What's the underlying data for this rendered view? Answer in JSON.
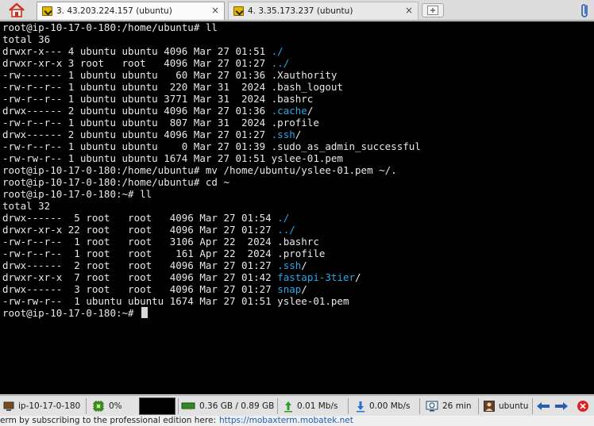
{
  "tabs": [
    {
      "label": "3. 43.203.224.157 (ubuntu)",
      "active": true
    },
    {
      "label": "4. 3.35.173.237 (ubuntu)",
      "active": false
    }
  ],
  "tab_close_glyph": "×",
  "terminal": {
    "colors": {
      "background": "#000000",
      "text": "#e8e8e8",
      "directory": "#2aa7e6"
    },
    "lines": [
      [
        {
          "t": "root@ip-10-17-0-180:/home/ubuntu# ll"
        }
      ],
      [
        {
          "t": "total 36"
        }
      ],
      [
        {
          "t": "drwxr-x--- 4 ubuntu ubuntu 4096 Mar 27 01:51 "
        },
        {
          "t": "./",
          "dir": true
        }
      ],
      [
        {
          "t": "drwxr-xr-x 3 root   root   4096 Mar 27 01:27 "
        },
        {
          "t": "../",
          "dir": true
        }
      ],
      [
        {
          "t": "-rw------- 1 ubuntu ubuntu   60 Mar 27 01:36 .Xauthority"
        }
      ],
      [
        {
          "t": "-rw-r--r-- 1 ubuntu ubuntu  220 Mar 31  2024 .bash_logout"
        }
      ],
      [
        {
          "t": "-rw-r--r-- 1 ubuntu ubuntu 3771 Mar 31  2024 .bashrc"
        }
      ],
      [
        {
          "t": "drwx------ 2 ubuntu ubuntu 4096 Mar 27 01:36 "
        },
        {
          "t": ".cache",
          "dir": true
        },
        {
          "t": "/"
        }
      ],
      [
        {
          "t": "-rw-r--r-- 1 ubuntu ubuntu  807 Mar 31  2024 .profile"
        }
      ],
      [
        {
          "t": "drwx------ 2 ubuntu ubuntu 4096 Mar 27 01:27 "
        },
        {
          "t": ".ssh",
          "dir": true
        },
        {
          "t": "/"
        }
      ],
      [
        {
          "t": "-rw-r--r-- 1 ubuntu ubuntu    0 Mar 27 01:39 .sudo_as_admin_successful"
        }
      ],
      [
        {
          "t": "-rw-rw-r-- 1 ubuntu ubuntu 1674 Mar 27 01:51 yslee-01.pem"
        }
      ],
      [
        {
          "t": "root@ip-10-17-0-180:/home/ubuntu# mv /home/ubuntu/yslee-01.pem ~/."
        }
      ],
      [
        {
          "t": "root@ip-10-17-0-180:/home/ubuntu# cd ~"
        }
      ],
      [
        {
          "t": "root@ip-10-17-0-180:~# ll"
        }
      ],
      [
        {
          "t": "total 32"
        }
      ],
      [
        {
          "t": "drwx------  5 root   root   4096 Mar 27 01:54 "
        },
        {
          "t": "./",
          "dir": true
        }
      ],
      [
        {
          "t": "drwxr-xr-x 22 root   root   4096 Mar 27 01:27 "
        },
        {
          "t": "../",
          "dir": true
        }
      ],
      [
        {
          "t": "-rw-r--r--  1 root   root   3106 Apr 22  2024 .bashrc"
        }
      ],
      [
        {
          "t": "-rw-r--r--  1 root   root    161 Apr 22  2024 .profile"
        }
      ],
      [
        {
          "t": "drwx------  2 root   root   4096 Mar 27 01:27 "
        },
        {
          "t": ".ssh",
          "dir": true
        },
        {
          "t": "/"
        }
      ],
      [
        {
          "t": "drwxr-xr-x  7 root   root   4096 Mar 27 01:42 "
        },
        {
          "t": "fastapi-3tier",
          "dir": true
        },
        {
          "t": "/"
        }
      ],
      [
        {
          "t": "drwx------  3 root   root   4096 Mar 27 01:27 "
        },
        {
          "t": "snap",
          "dir": true
        },
        {
          "t": "/"
        }
      ],
      [
        {
          "t": "-rw-rw-r--  1 ubuntu ubuntu 1674 Mar 27 01:51 yslee-01.pem"
        }
      ]
    ],
    "prompt": "root@ip-10-17-0-180:~# "
  },
  "statusbar": {
    "hostname": "ip-10-17-0-180",
    "cpu": "0%",
    "memory": "0.36 GB / 0.89 GB",
    "upload": "0.01 Mb/s",
    "download": "0.00 Mb/s",
    "uptime": "26 min",
    "user": "ubuntu"
  },
  "promo": {
    "text": "erm by subscribing to the professional edition here:",
    "link": "https://mobaxterm.mobatek.net"
  }
}
